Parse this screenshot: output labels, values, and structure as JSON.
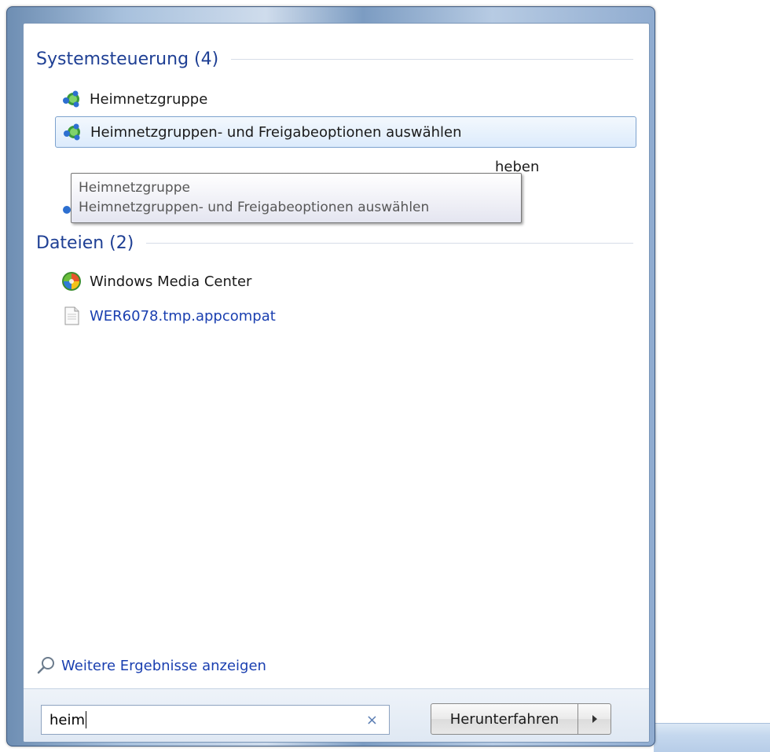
{
  "groups": {
    "control_panel": {
      "title": "Systemsteuerung (4)",
      "items": [
        {
          "label": "Heimnetzgruppe",
          "icon": "homegroup-icon"
        },
        {
          "label": "Heimnetzgruppen- und Freigabeoptionen auswählen",
          "icon": "homegroup-icon",
          "selected": true
        },
        {
          "label": "heben"
        }
      ]
    },
    "files": {
      "title": "Dateien (2)",
      "items": [
        {
          "label": "Windows Media Center",
          "icon": "media-center-icon"
        },
        {
          "label": "WER6078.tmp.appcompat",
          "icon": "file-icon"
        }
      ]
    }
  },
  "tooltip": {
    "line1": "Heimnetzgruppe",
    "line2": "Heimnetzgruppen- und Freigabeoptionen auswählen"
  },
  "more_results": "Weitere Ergebnisse anzeigen",
  "search": {
    "value": "heim",
    "clear_label": "×"
  },
  "shutdown": {
    "label": "Herunterfahren"
  },
  "colors": {
    "group_title": "#1e3f94",
    "link": "#1a3fb0",
    "selection_border": "#7da2ce"
  }
}
